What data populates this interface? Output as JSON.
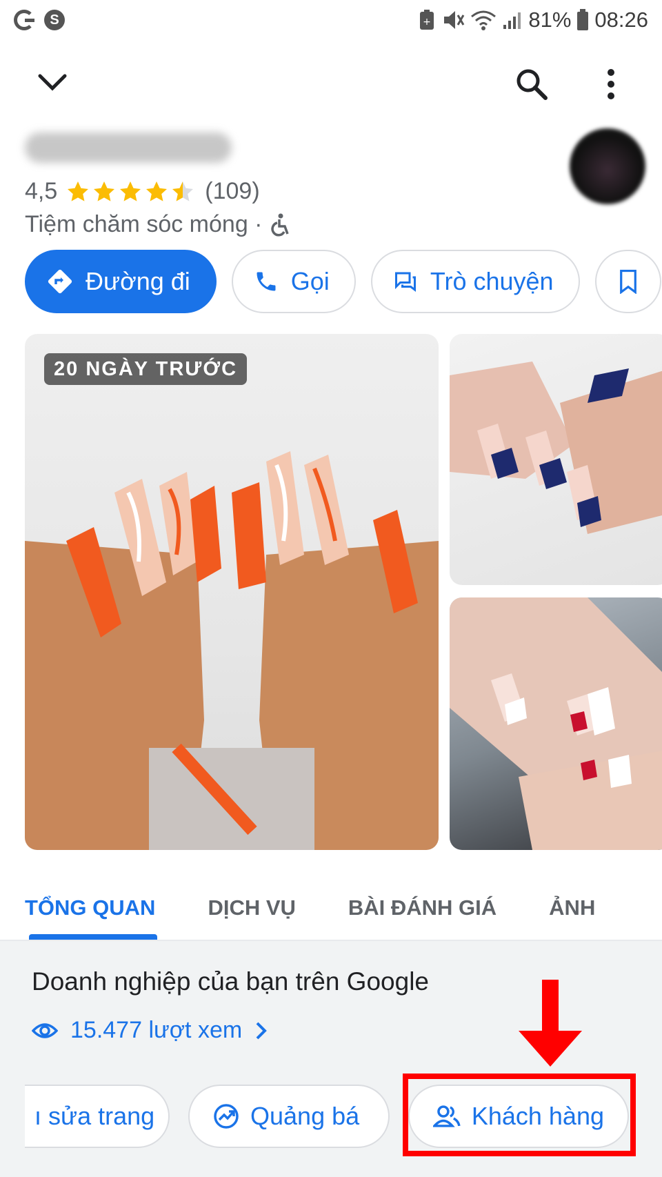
{
  "status_bar": {
    "battery": "81%",
    "time": "08:26"
  },
  "place": {
    "rating": "4,5",
    "stars": 4.5,
    "review_count": "(109)",
    "category": "Tiệm chăm sóc móng ·"
  },
  "actions": [
    {
      "label": "Đường đi",
      "icon": "directions-icon"
    },
    {
      "label": "Gọi",
      "icon": "phone-icon"
    },
    {
      "label": "Trò chuyện",
      "icon": "chat-icon"
    },
    {
      "label": "",
      "icon": "bookmark-icon"
    }
  ],
  "photo_badge": "20 NGÀY TRƯỚC",
  "tabs": [
    {
      "label": "TỔNG QUAN",
      "active": true
    },
    {
      "label": "DỊCH VỤ",
      "active": false
    },
    {
      "label": "BÀI ĐÁNH GIÁ",
      "active": false
    },
    {
      "label": "ẢNH",
      "active": false
    }
  ],
  "business": {
    "title": "Doanh nghiệp của bạn trên Google",
    "views": "15.477 lượt xem",
    "chips": [
      {
        "label": "ı sửa trang",
        "icon": ""
      },
      {
        "label": "Quảng bá",
        "icon": "trending-icon"
      },
      {
        "label": "Khách hàng",
        "icon": "people-icon"
      }
    ]
  },
  "colors": {
    "accent": "#1a73e8",
    "star": "#fbbc04",
    "annotation": "#ff0000"
  }
}
